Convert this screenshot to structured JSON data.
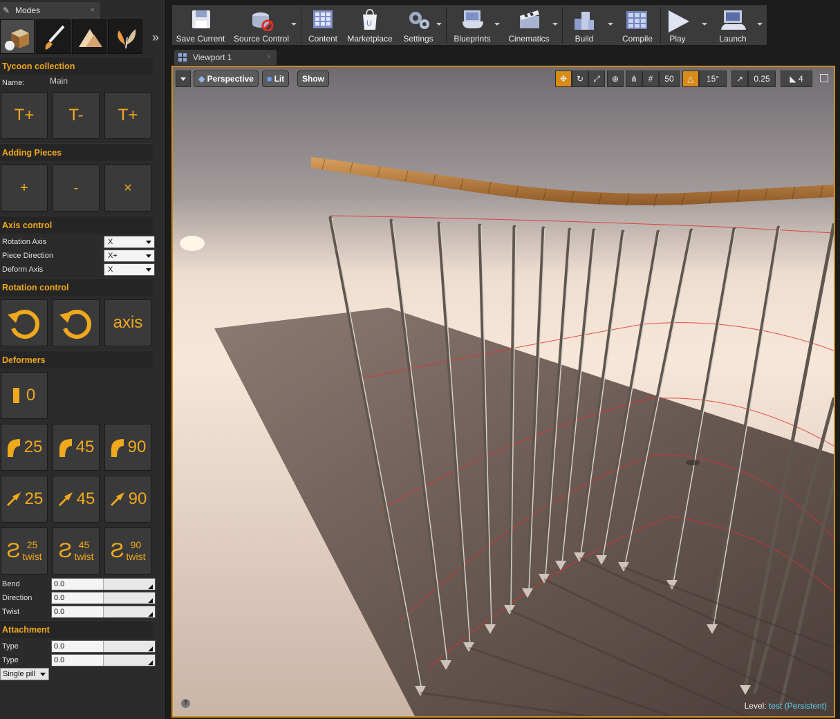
{
  "modes": {
    "tab_title": "Modes",
    "close_glyph": "×",
    "more_glyph": "»"
  },
  "tycoon": {
    "header": "Tycoon collection",
    "name_label": "Name:",
    "name_value": "Main",
    "btn1": "T+",
    "btn2": "T-",
    "btn3": "T+"
  },
  "adding": {
    "header": "Adding Pieces",
    "add": "+",
    "remove": "-",
    "clear": "×"
  },
  "axis": {
    "header": "Axis control",
    "rotation_axis_label": "Rotation Axis",
    "rotation_axis_value": "X",
    "piece_direction_label": "Piece Direction",
    "piece_direction_value": "X+",
    "deform_axis_label": "Deform Axis",
    "deform_axis_value": "X"
  },
  "rotation": {
    "header": "Rotation control",
    "axis_btn": "axis"
  },
  "deformers": {
    "header": "Deformers",
    "straight_value": "0",
    "bend_values": [
      "25",
      "45",
      "90"
    ],
    "dir_values": [
      "25",
      "45",
      "90"
    ],
    "twist_values": [
      "25",
      "45",
      "90"
    ],
    "twist_word": "twist",
    "bend_label": "Bend",
    "bend_value": "0.0",
    "direction_label": "Direction",
    "direction_value": "0.0",
    "twist_label": "Twist",
    "twist_value": "0.0"
  },
  "attachment": {
    "header": "Attachment",
    "type1_label": "Type",
    "type1_value": "0.0",
    "type2_label": "Type",
    "type2_value": "0.0",
    "mesh_value": "Single pill"
  },
  "toolbar": {
    "save": "Save Current",
    "source": "Source Control",
    "content": "Content",
    "marketplace": "Marketplace",
    "settings": "Settings",
    "blueprints": "Blueprints",
    "cinematics": "Cinematics",
    "build": "Build",
    "compile": "Compile",
    "play": "Play",
    "launch": "Launch"
  },
  "viewport": {
    "tab_title": "Viewport 1",
    "tab_close": "×",
    "perspective": "Perspective",
    "lit": "Lit",
    "show": "Show",
    "grid_snap": "50",
    "rot_snap": "15°",
    "scale_snap": "0.25",
    "cam_speed": "4",
    "level_label": "Level:",
    "level_name": "test (Persistent)",
    "help": "?"
  },
  "colors": {
    "accent": "#f0a81d",
    "panel": "#2b2b2b",
    "viewport_border": "#c98d19"
  }
}
